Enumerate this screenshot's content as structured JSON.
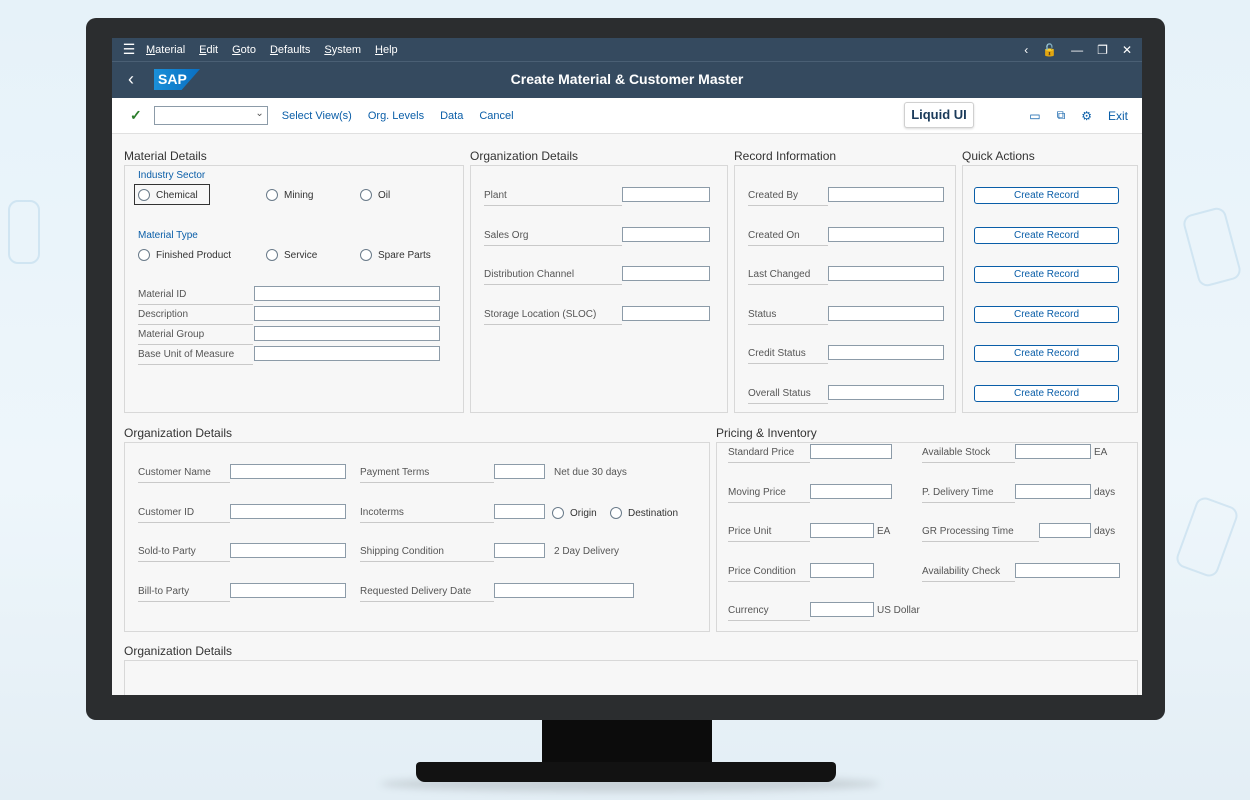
{
  "menu": {
    "items": [
      "Material",
      "Edit",
      "Goto",
      "Defaults",
      "System",
      "Help"
    ]
  },
  "window": {
    "title": "Create Material & Customer Master",
    "logo_text": "SAP"
  },
  "toolbar": {
    "links": [
      "Select View(s)",
      "Org. Levels",
      "Data",
      "Cancel"
    ],
    "liquid_label": "Liquid UI",
    "exit_label": "Exit",
    "dropdown_value": ""
  },
  "material": {
    "section_title": "Material Details",
    "industry_label": "Industry Sector",
    "industry_options": [
      "Chemical",
      "Mining",
      "Oil"
    ],
    "type_label": "Material Type",
    "type_options": [
      "Finished Product",
      "Service",
      "Spare Parts"
    ],
    "fields": [
      "Material ID",
      "Description",
      "Material Group",
      "Base Unit of Measure"
    ]
  },
  "org_top": {
    "section_title": "Organization Details",
    "fields": [
      "Plant",
      "Sales Org",
      "Distribution Channel",
      "Storage Location (SLOC)"
    ]
  },
  "record": {
    "section_title": "Record Information",
    "fields": [
      "Created By",
      "Created On",
      "Last Changed",
      "Status",
      "Credit Status",
      "Overall Status"
    ]
  },
  "quick": {
    "section_title": "Quick Actions",
    "buttons": [
      "Create Record",
      "Create Record",
      "Create Record",
      "Create Record",
      "Create Record",
      "Create Record"
    ]
  },
  "org_mid": {
    "section_title": "Organization Details",
    "left_fields": [
      "Customer Name",
      "Customer ID",
      "Sold-to Party",
      "Bill-to Party"
    ],
    "right_fields": [
      "Payment Terms",
      "Incoterms",
      "Shipping Condition",
      "Requested Delivery Date"
    ],
    "payment_note": "Net due 30 days",
    "incoterm_options": [
      "Origin",
      "Destination"
    ],
    "shipping_note": "2 Day Delivery"
  },
  "pricing": {
    "section_title": "Pricing & Inventory",
    "left_fields": [
      "Standard Price",
      "Moving Price",
      "Price Unit",
      "Price Condition",
      "Currency"
    ],
    "price_unit_suffix": "EA",
    "currency_suffix": "US Dollar",
    "right_fields": [
      "Available Stock",
      "P. Delivery Time",
      "GR Processing Time",
      "Availability Check"
    ],
    "stock_suffix": "EA",
    "delivery_suffix": "days",
    "gr_suffix": "days"
  },
  "org_bottom": {
    "section_title": "Organization Details"
  }
}
